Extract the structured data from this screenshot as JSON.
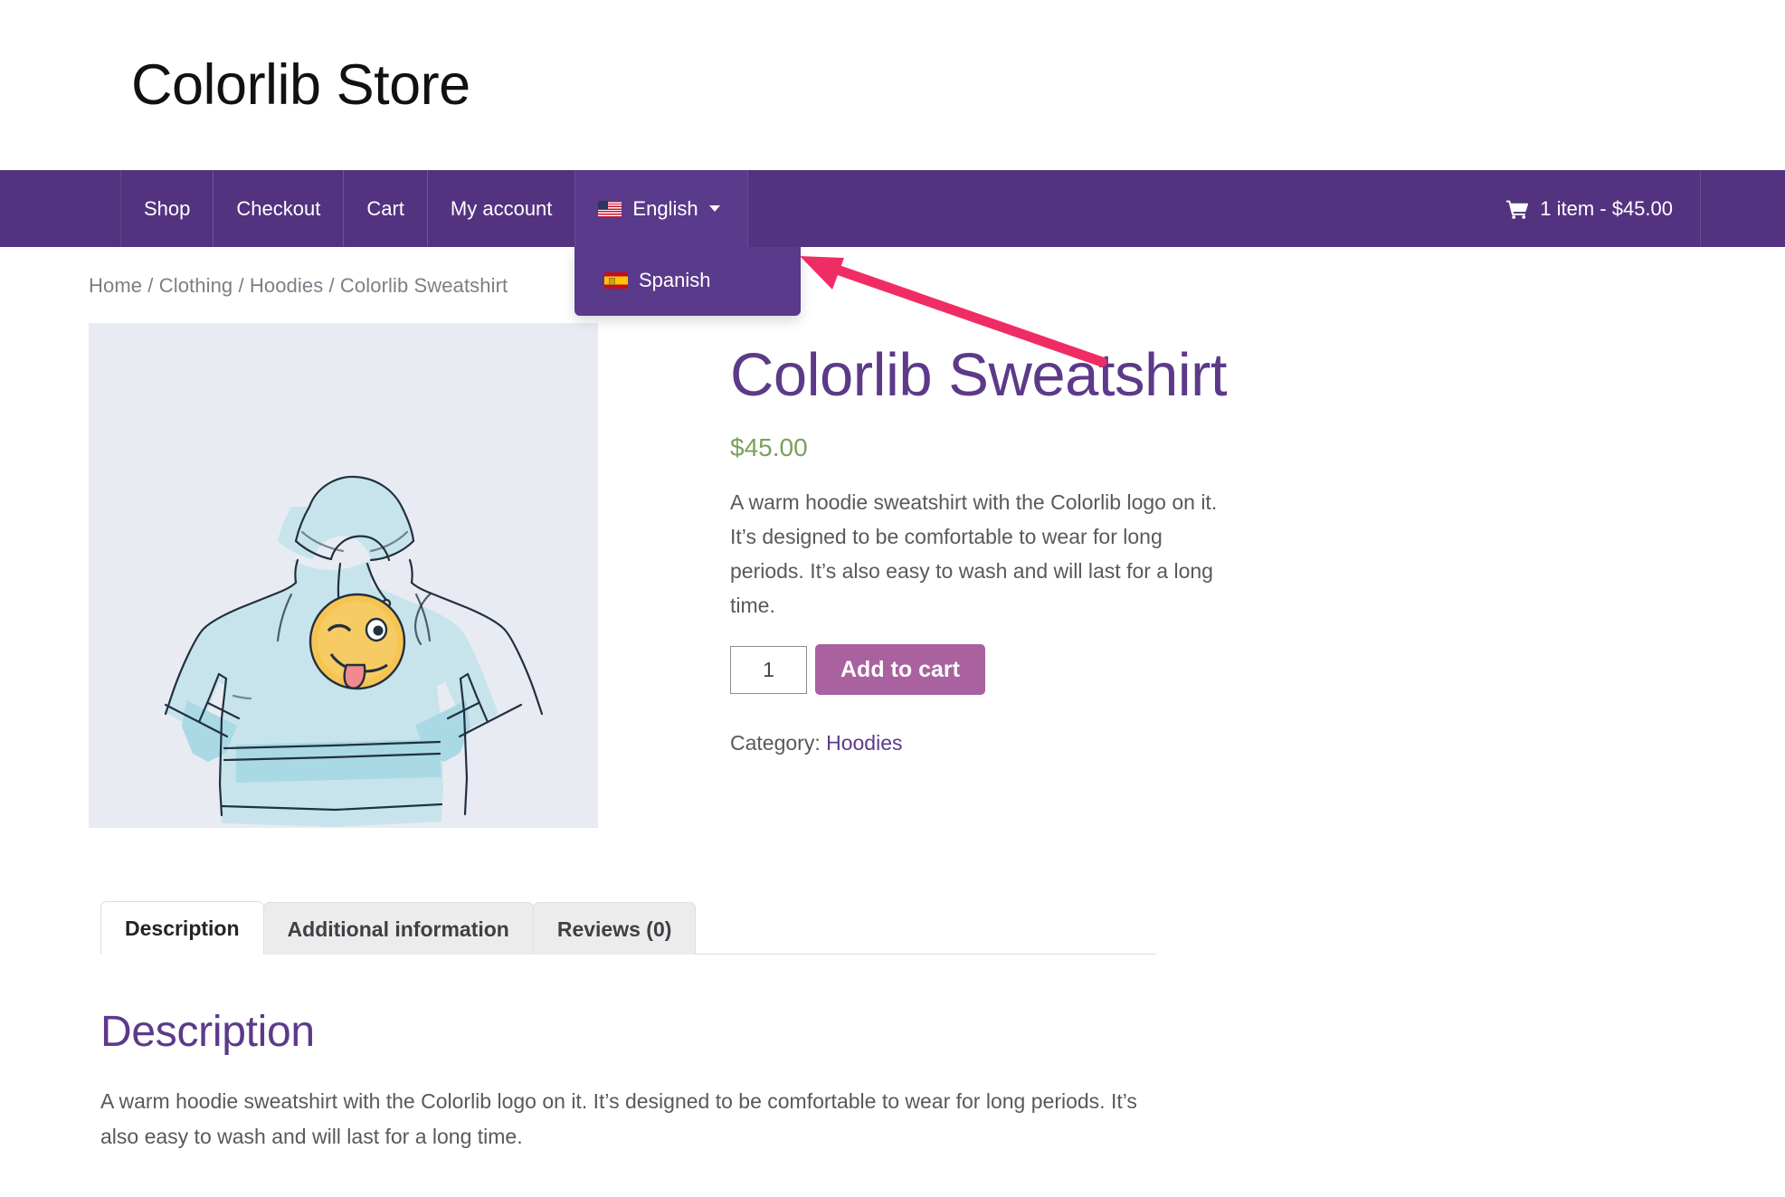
{
  "header": {
    "site_title": "Colorlib Store"
  },
  "nav": {
    "items": [
      {
        "label": "Shop",
        "name": "shop"
      },
      {
        "label": "Checkout",
        "name": "checkout"
      },
      {
        "label": "Cart",
        "name": "cart"
      },
      {
        "label": "My account",
        "name": "my-account"
      }
    ],
    "language": {
      "selected_label": "English",
      "selected_flag_icon": "us-flag-icon",
      "caret_icon": "chevron-down-icon",
      "options": [
        {
          "label": "Spanish",
          "flag_icon": "es-flag-icon"
        }
      ]
    },
    "cart": {
      "icon": "shopping-cart-icon",
      "label": "1 item - $45.00"
    }
  },
  "breadcrumb": {
    "text": "Home / Clothing / Hoodies / Colorlib Sweatshirt"
  },
  "product": {
    "image_alt": "hoodie-illustration",
    "title": "Colorlib Sweatshirt",
    "price": "$45.00",
    "short_description": "A warm hoodie sweatshirt with the Colorlib logo on it. It’s designed to be comfortable to wear for long periods. It’s also easy to wash and will last for a long time.",
    "quantity_value": "1",
    "add_to_cart_label": "Add to cart",
    "category_label": "Category:",
    "category_value": "Hoodies"
  },
  "tabs": {
    "items": [
      {
        "label": "Description",
        "active": true
      },
      {
        "label": "Additional information",
        "active": false
      },
      {
        "label": "Reviews (0)",
        "active": false
      }
    ]
  },
  "description_panel": {
    "heading": "Description",
    "body": "A warm hoodie sweatshirt with the Colorlib logo on it. It’s designed to be comfortable to wear for long periods. It’s also easy to wash and will last for a long time."
  },
  "annotation": {
    "arrow_color": "#ef2d64",
    "arrow_name": "pointer-arrow"
  },
  "colors": {
    "navbar": "#533280",
    "dropdown": "#5a3a8a",
    "brand_purple": "#5c3a89",
    "price_green": "#7ba05b",
    "button_magenta": "#a9619f",
    "image_bg": "#e9ebf3"
  }
}
